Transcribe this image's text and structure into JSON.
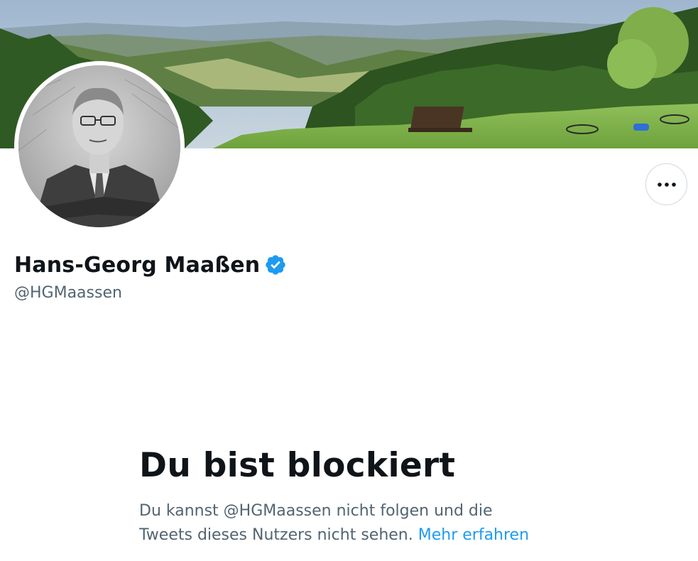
{
  "profile": {
    "display_name": "Hans-Georg Maaßen",
    "handle": "@HGMaassen",
    "verified": true
  },
  "icons": {
    "more": "more-horizontal-icon",
    "verified": "verified-badge-icon"
  },
  "blocked": {
    "title": "Du bist blockiert",
    "description_line1": "Du kannst @HGMaassen nicht folgen und die",
    "description_line2": "Tweets dieses Nutzers nicht sehen.",
    "learn_more": "Mehr erfahren"
  },
  "colors": {
    "text_primary": "#0f1419",
    "text_secondary": "#536471",
    "link": "#1d9bf0",
    "verified": "#1d9bf0",
    "border": "#cfd9de"
  }
}
